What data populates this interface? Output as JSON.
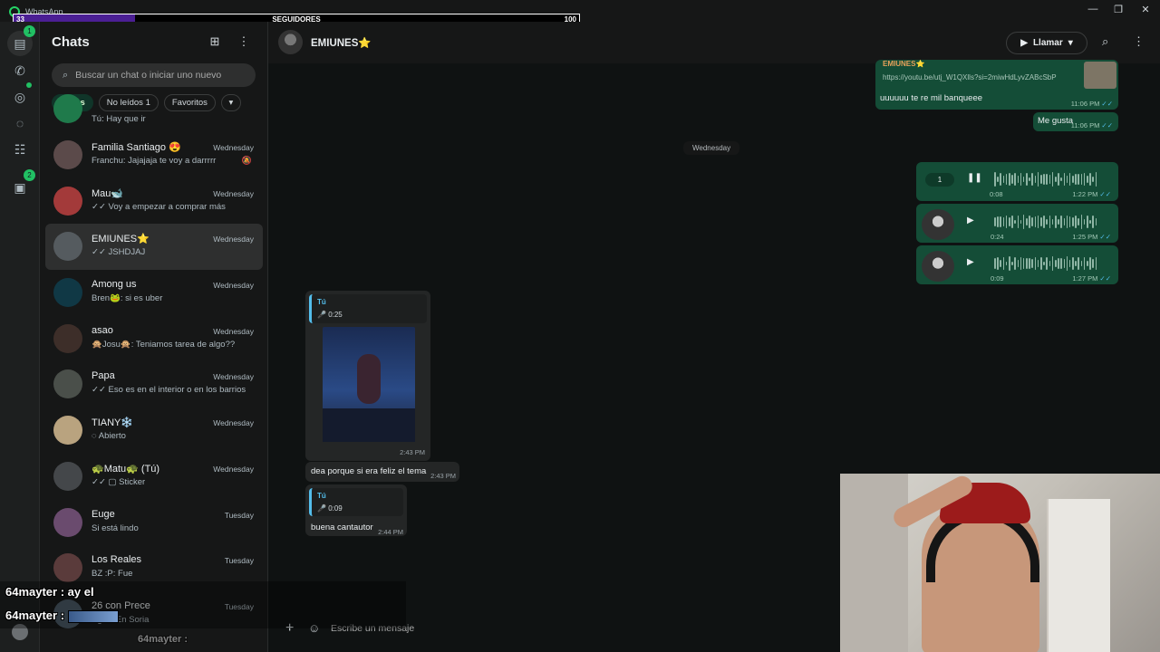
{
  "titlebar": {
    "app_name": "WhatsApp",
    "minimize": "—",
    "maximize": "❐",
    "close": "✕"
  },
  "followers_bar": {
    "current": "33",
    "label": "SEGUIDORES",
    "goal": "100",
    "progress_fraction": 0.33
  },
  "rail": {
    "chats_badge": "1",
    "communities_badge": "2"
  },
  "sidebar": {
    "title": "Chats",
    "search_placeholder": "Buscar un chat o iniciar uno nuevo",
    "filters": [
      "Todos",
      "No leídos 1",
      "Favoritos"
    ],
    "partial_row_msg": "Tú: Hay que ir",
    "chats": [
      {
        "name": "Familia Santiago 😍",
        "time": "Wednesday",
        "msg": "Franchu: Jajajaja te voy a darrrrr",
        "muted": true,
        "avatar_color": "#5b4a4a"
      },
      {
        "name": "Mau🐋",
        "time": "Wednesday",
        "msg": "✓✓ Voy a empezar a comprar más",
        "avatar_color": "#a33a3a"
      },
      {
        "name": "EMIUNES⭐",
        "time": "Wednesday",
        "msg": "✓✓ JSHDJAJ",
        "selected": true,
        "avatar_color": "#555b5f"
      },
      {
        "name": "Among us",
        "time": "Wednesday",
        "msg": "Bren🐸: si es uber",
        "avatar_color": "#103845"
      },
      {
        "name": "asao",
        "time": "Wednesday",
        "msg": "🙊Josu🙊: Teniamos tarea de algo??",
        "avatar_color": "#3d2e29"
      },
      {
        "name": "Papa",
        "time": "Wednesday",
        "msg": "✓✓ Eso es en el interior o en los barrios",
        "avatar_color": "#4a4f4a"
      },
      {
        "name": "TIANY❄️",
        "time": "Wednesday",
        "msg": "◌ Abierto",
        "avatar_color": "#b9a37f"
      },
      {
        "name": "🐢Matu🐢 (Tú)",
        "time": "Wednesday",
        "msg": "✓✓ ▢ Sticker",
        "avatar_color": "#44474a"
      },
      {
        "name": "Euge",
        "time": "Tuesday",
        "msg": "Si está lindo",
        "avatar_color": "#6a4b6e"
      },
      {
        "name": "Los Reales",
        "time": "Tuesday",
        "msg": "BZ :P: Fue",
        "avatar_color": "#5a3b3b"
      },
      {
        "name": "26 con Prece",
        "time": "Tuesday",
        "msg": "Agos: En Soria",
        "avatar_color": "#4a5a66"
      }
    ]
  },
  "header": {
    "contact_name": "EMIUNES⭐",
    "call_label": "Llamar"
  },
  "messages": {
    "link_sender": "EMIUNES⭐",
    "link_url": "https://youtu.be/utj_W1QXlls?si=2miwHdLyvZABcSbP",
    "link_text": "uuuuuu te re mil banqueee",
    "link_time": "11:06 PM",
    "me_gusta": "Me gusta",
    "me_gusta_time": "11:06 PM",
    "day_separator": "Wednesday",
    "voice1_speed": "1",
    "voice1_dur": "0:08",
    "voice1_time": "1:22 PM",
    "voice2_dur": "0:24",
    "voice2_time": "1:25 PM",
    "voice3_dur": "0:09",
    "voice3_time": "1:27 PM",
    "reply1_name": "Tú",
    "reply1_dur": "0:25",
    "image_time": "2:43 PM",
    "text1": "dea porque si era feliz el tema",
    "text1_time": "2:43 PM",
    "reply2_name": "Tú",
    "reply2_dur": "0:09",
    "text2": "buena cantautor",
    "text2_time": "2:44 PM"
  },
  "composer": {
    "placeholder": "Escribe un mensaje"
  },
  "stream_chat": {
    "line1_user": "64mayter",
    "line1_text": "ay el",
    "line2_user": "64mayter",
    "line3_user": "64mayter"
  },
  "colors": {
    "accent": "#21c063",
    "outgoing_bubble": "#144d37",
    "incoming_bubble": "#242626",
    "read_tick": "#53bdeb",
    "follow_bar_fill": "#4b1f94"
  }
}
